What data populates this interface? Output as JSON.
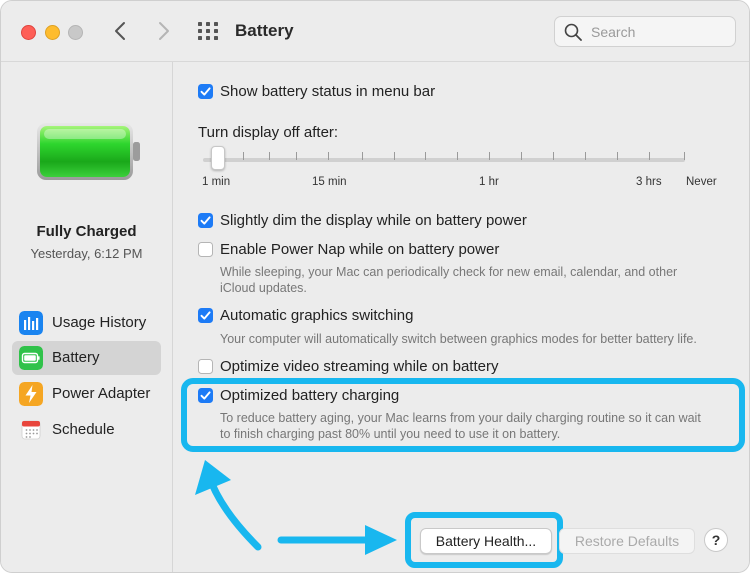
{
  "window": {
    "title": "Battery"
  },
  "search": {
    "placeholder": "Search"
  },
  "sidebar": {
    "status_title": "Fully Charged",
    "status_time": "Yesterday, 6:12 PM",
    "items": [
      {
        "label": "Usage History",
        "icon": "bar-chart-icon",
        "color": "#1a84f0"
      },
      {
        "label": "Battery",
        "icon": "battery-icon",
        "color": "#30c24a"
      },
      {
        "label": "Power Adapter",
        "icon": "lightning-icon",
        "color": "#f5a623"
      },
      {
        "label": "Schedule",
        "icon": "calendar-icon",
        "color": "#e8453c"
      }
    ],
    "selected": "Battery"
  },
  "options": {
    "show_status": {
      "label": "Show battery status in menu bar",
      "checked": true
    },
    "display_off": {
      "label": "Turn display off after:",
      "ticks": {
        "min1": "1 min",
        "min15": "15 min",
        "hr1": "1 hr",
        "hrs3": "3 hrs",
        "never": "Never"
      },
      "value": "1 min"
    },
    "dim": {
      "label": "Slightly dim the display while on battery power",
      "checked": true
    },
    "power_nap": {
      "label": "Enable Power Nap while on battery power",
      "checked": false,
      "desc_line1": "While sleeping, your Mac can periodically check for new email, calendar, and other",
      "desc_line2": "iCloud updates."
    },
    "graphics": {
      "label": "Automatic graphics switching",
      "checked": true,
      "desc": "Your computer will automatically switch between graphics modes for better battery life."
    },
    "video": {
      "label": "Optimize video streaming while on battery",
      "checked": false
    },
    "optimized_charging": {
      "label": "Optimized battery charging",
      "checked": true,
      "desc_line1": "To reduce battery aging, your Mac learns from your daily charging routine so it can wait",
      "desc_line2": "to finish charging past 80% until you need to use it on battery."
    }
  },
  "buttons": {
    "battery_health": "Battery Health...",
    "restore_defaults": "Restore Defaults",
    "help": "?"
  },
  "colors": {
    "accent": "#1d7bf6",
    "highlight": "#18b7ef",
    "battery_green": "#2ecc2e"
  }
}
